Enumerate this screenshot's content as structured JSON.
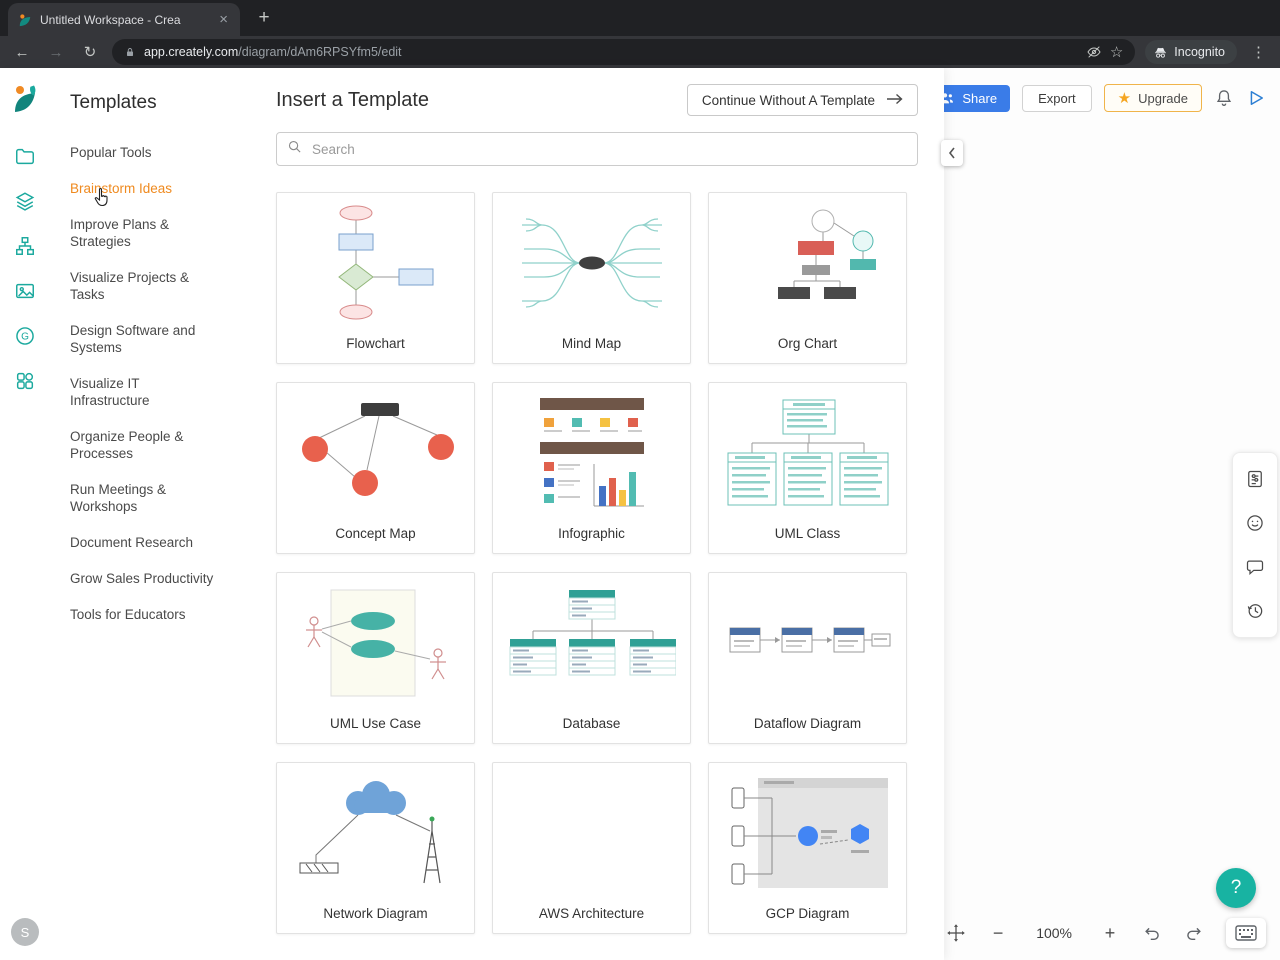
{
  "colors": {
    "brand_teal": "#1ba99e",
    "active_nav_orange": "#ef8a1f",
    "share_blue": "#3a7ce8",
    "upgrade_orange": "#f5a623",
    "help_teal": "#18b3a2"
  },
  "browser": {
    "tab_title": "Untitled Workspace - Crea",
    "url_domain": "app.creately.com",
    "url_path": "/diagram/dAm6RPSYfm5/edit",
    "incognito_label": "Incognito"
  },
  "templates_nav": {
    "title": "Templates",
    "items": [
      {
        "label": "Popular Tools"
      },
      {
        "label": "Brainstorm Ideas"
      },
      {
        "label": "Improve Plans & Strategies"
      },
      {
        "label": "Visualize Projects & Tasks"
      },
      {
        "label": "Design Software and Systems"
      },
      {
        "label": "Visualize IT Infrastructure"
      },
      {
        "label": "Organize People & Processes"
      },
      {
        "label": "Run Meetings & Workshops"
      },
      {
        "label": "Document Research"
      },
      {
        "label": "Grow Sales Productivity"
      },
      {
        "label": "Tools for Educators"
      }
    ]
  },
  "template_picker": {
    "title": "Insert a Template",
    "continue_button_label": "Continue Without A Template",
    "search_placeholder": "Search",
    "cards": [
      {
        "label": "Flowchart"
      },
      {
        "label": "Mind Map"
      },
      {
        "label": "Org Chart"
      },
      {
        "label": "Concept Map"
      },
      {
        "label": "Infographic"
      },
      {
        "label": "UML Class"
      },
      {
        "label": "UML Use Case"
      },
      {
        "label": "Database"
      },
      {
        "label": "Dataflow Diagram"
      },
      {
        "label": "Network Diagram"
      },
      {
        "label": "AWS Architecture"
      },
      {
        "label": "GCP Diagram"
      }
    ]
  },
  "canvas_toolbar": {
    "share_label": "Share",
    "export_label": "Export",
    "upgrade_label": "Upgrade"
  },
  "status_bar": {
    "zoom_level": "100%"
  },
  "user": {
    "avatar_initial": "S"
  }
}
